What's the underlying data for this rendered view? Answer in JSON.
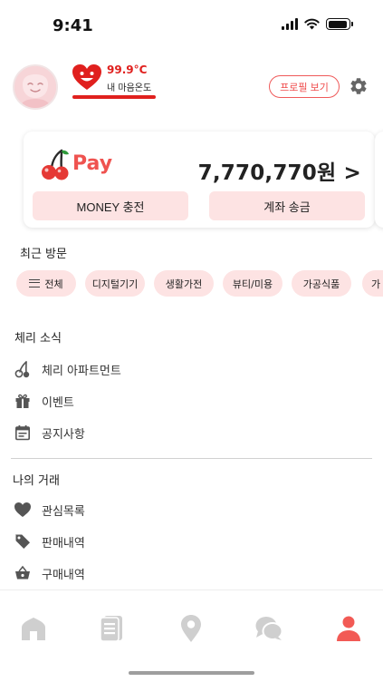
{
  "status_bar": {
    "time": "9:41"
  },
  "profile": {
    "temperature": "99.9°C",
    "temperature_label": "내 마음온도",
    "profile_button": "프로필 보기"
  },
  "pay": {
    "brand": "Pay",
    "balance": "7,770,770원 >",
    "charge_button": "MONEY 충전",
    "transfer_button": "계좌 송금"
  },
  "recent": {
    "title": "최근 방문",
    "chips": [
      "전체",
      "디지털기기",
      "생활가전",
      "뷰티/미용",
      "가공식품",
      "가"
    ]
  },
  "news": {
    "title": "체리 소식",
    "items": [
      "체리 아파트먼트",
      "이벤트",
      "공지사항"
    ]
  },
  "trades": {
    "title": "나의 거래",
    "items": [
      "관심목록",
      "판매내역",
      "구매내역"
    ]
  },
  "nav": {
    "items": [
      {
        "icon": "home-icon",
        "active": false
      },
      {
        "icon": "list-icon",
        "active": false
      },
      {
        "icon": "location-icon",
        "active": false
      },
      {
        "icon": "chat-icon",
        "active": false
      },
      {
        "icon": "person-icon",
        "active": true
      }
    ]
  },
  "colors": {
    "accent": "#ef5350",
    "chip_background": "#fde3e3",
    "nav_inactive": "#cfcfcf",
    "nav_active": "#f25a55"
  }
}
